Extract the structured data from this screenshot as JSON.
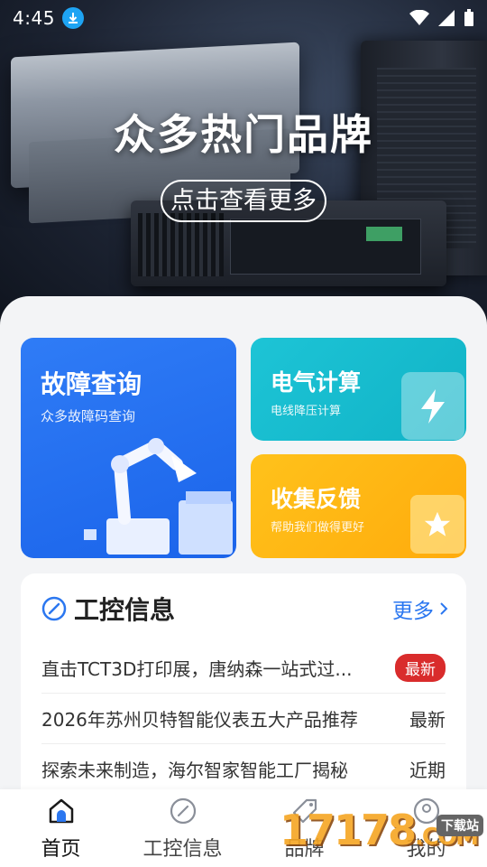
{
  "status_bar": {
    "time": "4:45"
  },
  "banner": {
    "title": "众多热门品牌",
    "button_label": "点击查看更多"
  },
  "cards": {
    "fault": {
      "title": "故障查询",
      "subtitle": "众多故障码查询"
    },
    "electrical": {
      "title": "电气计算",
      "subtitle": "电线降压计算"
    },
    "feedback": {
      "title": "收集反馈",
      "subtitle": "帮助我们做得更好"
    }
  },
  "news": {
    "title": "工控信息",
    "more_label": "更多",
    "items": [
      {
        "title": "直击TCT3D打印展，唐纳森一站式过...",
        "tag": "最新",
        "tag_style": "red"
      },
      {
        "title": "2026年苏州贝特智能仪表五大产品推荐",
        "tag": "最新",
        "tag_style": "plain"
      },
      {
        "title": "探索未来制造，海尔智家智能工厂揭秘",
        "tag": "近期",
        "tag_style": "plain"
      }
    ]
  },
  "bottom_nav": {
    "items": [
      {
        "label": "首页",
        "icon": "home-icon",
        "active": true
      },
      {
        "label": "工控信息",
        "icon": "compass-icon",
        "active": false
      },
      {
        "label": "品牌",
        "icon": "tag-icon",
        "active": false
      },
      {
        "label": "我的",
        "icon": "user-icon",
        "active": false
      }
    ]
  },
  "watermark": {
    "text": "17178",
    "suffix": ".COM",
    "badge": "下载站"
  },
  "colors": {
    "accent_blue": "#2b77f0",
    "fault_card": "#1f6cf0",
    "electrical_card": "#16bccd",
    "feedback_card": "#ffb512",
    "tag_red": "#d92c2c"
  }
}
